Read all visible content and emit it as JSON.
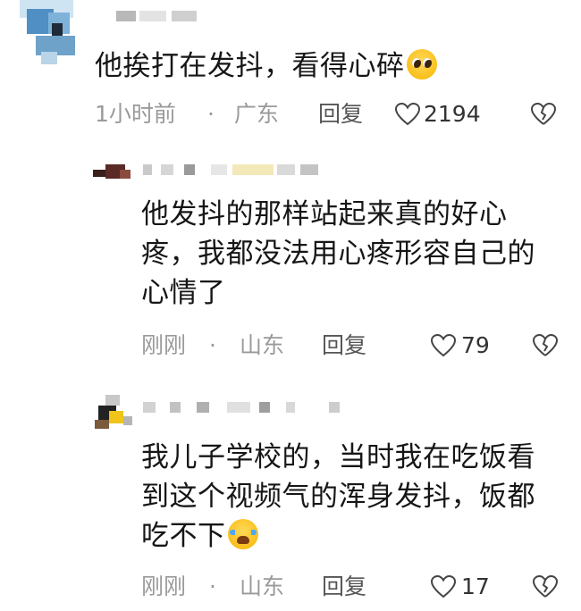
{
  "comments": [
    {
      "text": "他挨打在发抖，看得心碎",
      "time": "1小时前",
      "separator": "·",
      "location": "广东",
      "reply_label": "回复",
      "likes": "2194",
      "emoji": "pleading-face"
    },
    {
      "text": "他发抖的那样站起来真的好心疼，我都没法用心疼形容自己的心情了",
      "time": "刚刚",
      "separator": "·",
      "location": "山东",
      "reply_label": "回复",
      "likes": "79"
    },
    {
      "text": "我儿子学校的，当时我在吃饭看到这个视频气的浑身发抖，饭都吃不下",
      "time": "刚刚",
      "separator": "·",
      "location": "山东",
      "reply_label": "回复",
      "likes": "17",
      "emoji": "loudly-crying-face"
    }
  ],
  "icons": {
    "like": "heart-outline-icon",
    "dislike": "broken-heart-icon"
  },
  "colors": {
    "text": "#161616",
    "meta": "#9a9a9a",
    "reply": "#555555"
  }
}
